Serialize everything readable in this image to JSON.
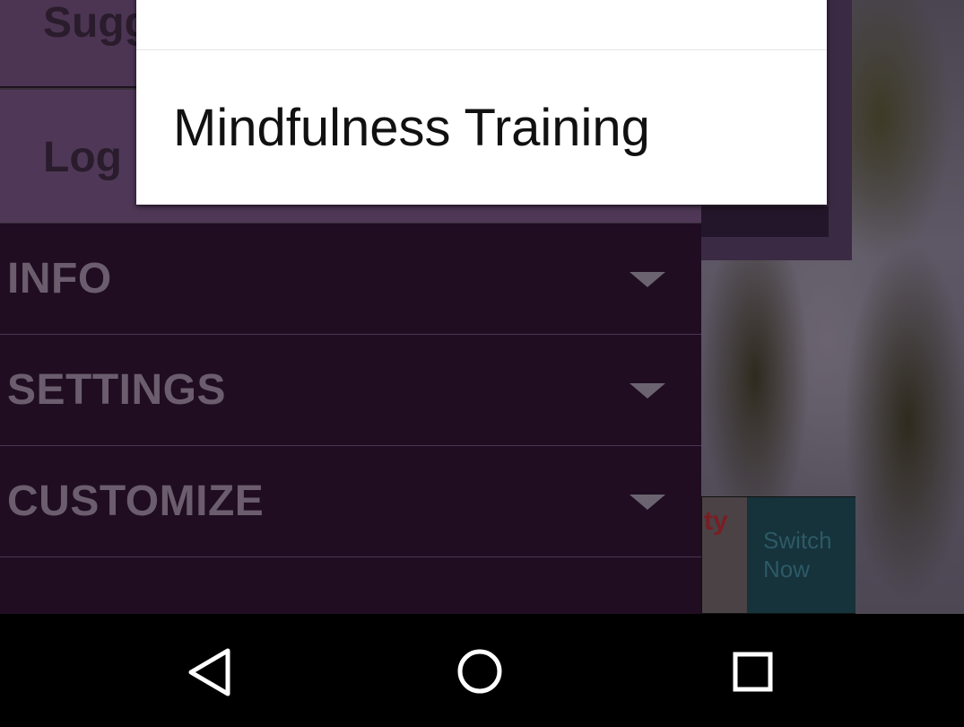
{
  "drawer": {
    "top_items": [
      {
        "label": "Sugg"
      },
      {
        "label": "Log"
      }
    ],
    "sections": [
      {
        "label": "INFO",
        "expand_icon": "chevron-down-icon"
      },
      {
        "label": "SETTINGS",
        "expand_icon": "chevron-down-icon"
      },
      {
        "label": "CUSTOMIZE",
        "expand_icon": "chevron-down-icon"
      }
    ]
  },
  "popup_menu": {
    "items": [
      {
        "label": "Mindfulness Training"
      }
    ]
  },
  "background_app": {
    "banner_partial_text": "ty",
    "banner_button_label": "Switch Now"
  },
  "system_nav": {
    "buttons": [
      "back-icon",
      "home-icon",
      "recents-icon"
    ]
  },
  "colors": {
    "drawer_bg": "#200d22",
    "drawer_top_bg": "#4c3553",
    "section_text": "#6b5d6d",
    "popup_bg": "#ffffff",
    "nav_bar_bg": "#000000"
  }
}
